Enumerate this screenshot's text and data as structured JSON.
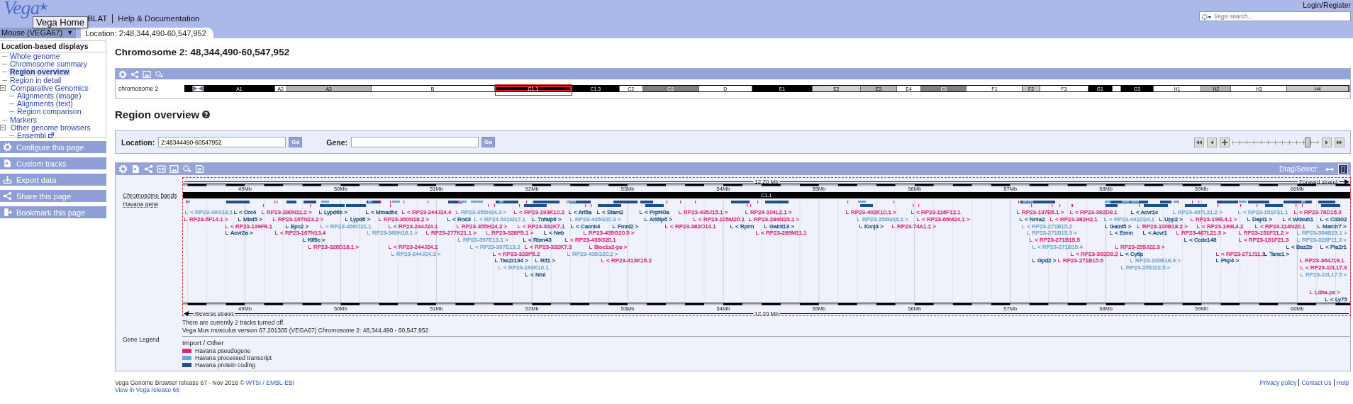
{
  "header": {
    "logo": "Vega",
    "tooltip": "Vega Home",
    "links": [
      "BLAT",
      "Help & Documentation"
    ],
    "login": "Login/Register",
    "search": {
      "placeholder": "Vega search..."
    }
  },
  "species_selector": {
    "label": "Mouse (VEGA67)",
    "caret": "▼"
  },
  "tabs": [
    {
      "label": "Location: 2:48,344,490-60,547,952",
      "selected": true
    }
  ],
  "sidebar": {
    "title": "Location-based displays",
    "items": [
      {
        "label": "Whole genome",
        "selected": false
      },
      {
        "label": "Chromosome summary",
        "selected": false
      },
      {
        "label": "Region overview",
        "selected": true
      },
      {
        "label": "Region in detail",
        "selected": false
      },
      {
        "label": "Comparative Genomics",
        "selected": false,
        "expanded": true,
        "children": [
          {
            "label": "Alignments (image)",
            "selected": false
          },
          {
            "label": "Alignments (text)",
            "selected": false
          },
          {
            "label": "Region comparison",
            "selected": false
          }
        ]
      },
      {
        "label": "Markers",
        "selected": false
      },
      {
        "label": "Other genome browsers",
        "selected": false,
        "expanded": true,
        "children": [
          {
            "label": "Ensembl",
            "selected": false,
            "external": true
          }
        ]
      }
    ]
  },
  "sidebar_buttons": [
    "Configure this page",
    "Custom tracks",
    "Export data",
    "Share this page",
    "Bookmark this page"
  ],
  "page_title": "Chromosome 2: 48,344,490-60,547,952",
  "ideogram": {
    "label": "chromosome 2",
    "bands": [
      {
        "label": "A1",
        "color": "#000000",
        "selected": false
      },
      {
        "label": "A2",
        "color": "#ffffff",
        "selected": false
      },
      {
        "label": "A3",
        "color": "#b4b4b4",
        "selected": false
      },
      {
        "label": "B",
        "color": "#ffffff",
        "selected": false
      },
      {
        "label": "C1.1",
        "color": "#000000",
        "selected": true
      },
      {
        "label": "C1.3",
        "color": "#000000",
        "selected": false
      },
      {
        "label": "C2",
        "color": "#ffffff",
        "selected": false
      },
      {
        "label": "C3",
        "color": "#808080",
        "selected": false
      },
      {
        "label": "D",
        "color": "#ffffff",
        "selected": false
      },
      {
        "label": "E1",
        "color": "#000000",
        "selected": false
      },
      {
        "label": "E2",
        "color": "#d2d2d2",
        "selected": false
      },
      {
        "label": "E3",
        "color": "#b4b4b4",
        "selected": false
      },
      {
        "label": "E4",
        "color": "#ffffff",
        "selected": false
      },
      {
        "label": "E5",
        "color": "#808080",
        "selected": false
      },
      {
        "label": "F1",
        "color": "#ffffff",
        "selected": false
      },
      {
        "label": "F2",
        "color": "#c8c8c8",
        "selected": false
      },
      {
        "label": "F3",
        "color": "#ffffff",
        "selected": false
      },
      {
        "label": "G1",
        "color": "#000000",
        "selected": false
      },
      {
        "color": "#ffffff",
        "selected": false
      },
      {
        "label": "G3",
        "color": "#000000",
        "selected": false
      },
      {
        "label": "H1",
        "color": "#ffffff",
        "selected": false
      },
      {
        "label": "H2",
        "color": "#b4b4b4",
        "selected": false
      },
      {
        "label": "H3",
        "color": "#ffffff",
        "selected": false
      },
      {
        "label": "H4",
        "color": "#c8c8c8",
        "selected": false
      }
    ]
  },
  "region_heading": "Region overview",
  "location_form": {
    "fields": [
      {
        "label": "Location:",
        "value": "2:48344490-60547952",
        "button": "Go"
      },
      {
        "label": "Gene:",
        "button": "Go"
      }
    ],
    "zoom_slider": {
      "level": 0.87
    }
  },
  "track_panel": {
    "drag_select": {
      "label": "Drag/Select:",
      "modes": [
        {
          "selected": false
        },
        {
          "selected": true
        }
      ]
    },
    "track_labels": [
      "Chromosome bands",
      "Havana gene"
    ],
    "scale_top": "12.20 Mb",
    "forward_strand": "Forward strand",
    "ruler_top": [
      "49Mb",
      "50Mb",
      "51Mb",
      "52Mb",
      "53Mb",
      "54Mb",
      "55Mb",
      "56Mb",
      "57Mb",
      "58Mb",
      "59Mb",
      "60Mb"
    ],
    "band": "C1.1",
    "genes": [
      {
        "label": "< RP23-49G18.1",
        "color": "#72a6d8"
      },
      {
        "label": "< Orc4",
        "color": "#1c4f8c"
      },
      {
        "label": "RP23-280N11.2 >",
        "color": "#dc2a7c"
      },
      {
        "label": "Lypd6b >",
        "color": "#1c4f8c"
      },
      {
        "label": "< Mmadhc",
        "color": "#1c4f8c"
      },
      {
        "label": "< RP23-244J24.4",
        "color": "#dc2a7c"
      },
      {
        "label": "RP23-355H24.3 >",
        "color": "#72a6d8"
      },
      {
        "label": "< RP23-193K10.2",
        "color": "#dc2a7c"
      },
      {
        "label": "< Arl5a",
        "color": "#1c4f8c"
      },
      {
        "label": "< Stam2",
        "color": "#1c4f8c"
      },
      {
        "label": "< Prpf40a",
        "color": "#1c4f8c"
      },
      {
        "label": "RP23-435J15.1 >",
        "color": "#dc2a7c"
      },
      {
        "label": "RP24-104L2.1 >",
        "color": "#dc2a7c"
      },
      {
        "label": "RP23-402K10.1 >",
        "color": "#dc2a7c"
      },
      {
        "label": "< RP23-116F12.1",
        "color": "#dc2a7c"
      },
      {
        "label": "RP23-137E6.1 >",
        "color": "#dc2a7c"
      },
      {
        "label": "< RP23-392D9.1",
        "color": "#dc2a7c"
      },
      {
        "label": "< Acvr1c",
        "color": "#1c4f8c"
      },
      {
        "label": "RP23-467L21.2 >",
        "color": "#72a6d8"
      },
      {
        "label": "< RP23-151F21.1",
        "color": "#72a6d8"
      },
      {
        "label": "< RP23-78D16.3",
        "color": "#dc2a7c"
      },
      {
        "label": "RP23-5F14.1 >",
        "color": "#dc2a7c"
      },
      {
        "label": "Mbd5 >",
        "color": "#1c4f8c"
      },
      {
        "label": "RP23-167N13.2 >",
        "color": "#dc2a7c"
      },
      {
        "label": "Lypd6 >",
        "color": "#1c4f8c"
      },
      {
        "label": "RP23-360N18.2 >",
        "color": "#dc2a7c"
      },
      {
        "label": "< Rnd3",
        "color": "#1c4f8c"
      },
      {
        "label": "< RP24-531M17.1",
        "color": "#72a6d8"
      },
      {
        "label": "Tnfaip6 >",
        "color": "#1c4f8c"
      },
      {
        "label": "RP23-435G20.3 >",
        "color": "#72a6d8"
      },
      {
        "label": "Arl6ip6 >",
        "color": "#1c4f8c"
      },
      {
        "label": "< RP23-105M20.1",
        "color": "#dc2a7c"
      },
      {
        "label": "RP23-284N23.1 >",
        "color": "#dc2a7c"
      },
      {
        "label": "RP23-256M16.1 >",
        "color": "#72a6d8"
      },
      {
        "label": "< RP23-66M24.1 >",
        "color": "#dc2a7c"
      },
      {
        "label": "< Nr4a2",
        "color": "#1c4f8c"
      },
      {
        "label": "< RP23-382H2.1",
        "color": "#dc2a7c"
      },
      {
        "label": "< RP23-441D24.1",
        "color": "#72a6d8"
      },
      {
        "label": "Upp2 >",
        "color": "#1c4f8c"
      },
      {
        "label": "RP23-199L4.1 >",
        "color": "#dc2a7c"
      },
      {
        "label": "Dapl1 >",
        "color": "#1c4f8c"
      },
      {
        "label": "< Wdsub1",
        "color": "#1c4f8c"
      },
      {
        "label": "< Cd302",
        "color": "#1c4f8c"
      },
      {
        "label": "< RP23-139F8.1",
        "color": "#dc2a7c"
      },
      {
        "label": "Epc2 >",
        "color": "#1c4f8c"
      },
      {
        "label": "< RP23-466O21.1",
        "color": "#72a6d8"
      },
      {
        "label": "< RP23-244J24.1",
        "color": "#dc2a7c"
      },
      {
        "label": "RP23-355H24.2 >",
        "color": "#dc2a7c"
      },
      {
        "label": "< RP23-332K7.1",
        "color": "#dc2a7c"
      },
      {
        "label": "< Cacnb4",
        "color": "#1c4f8c"
      },
      {
        "label": "Fmnl2 >",
        "color": "#1c4f8c"
      },
      {
        "label": "< RP23-382O14.1",
        "color": "#dc2a7c"
      },
      {
        "label": "< Rprm",
        "color": "#1c4f8c"
      },
      {
        "label": "Galnt13 >",
        "color": "#1c4f8c"
      },
      {
        "label": "Kcnj3 >",
        "color": "#1c4f8c"
      },
      {
        "label": "RP23-74A1.1 >",
        "color": "#dc2a7c"
      },
      {
        "label": "< RP23-271B15.2",
        "color": "#72a6d8"
      },
      {
        "label": "Galnt5 >",
        "color": "#1c4f8c"
      },
      {
        "label": "RP23-100B18.2 >",
        "color": "#dc2a7c"
      },
      {
        "label": "< RP23-199L4.2",
        "color": "#dc2a7c"
      },
      {
        "label": "< RP23-114N20.1",
        "color": "#dc2a7c"
      },
      {
        "label": "March7 >",
        "color": "#1c4f8c"
      },
      {
        "label": "Acvr2a >",
        "color": "#1c4f8c"
      },
      {
        "label": "< RP23-167N13.4",
        "color": "#dc2a7c"
      },
      {
        "label": "RP23-360N18.1 >",
        "color": "#72a6d8"
      },
      {
        "label": "RP23-277K21.1 >",
        "color": "#dc2a7c"
      },
      {
        "label": "RP23-328P5.1 >",
        "color": "#dc2a7c"
      },
      {
        "label": "< Neb",
        "color": "#1c4f8c"
      },
      {
        "label": "RP23-435G20.5 >",
        "color": "#dc2a7c"
      },
      {
        "label": "< RP23-289M11.1",
        "color": "#dc2a7c"
      },
      {
        "label": "RP23-271B15.3 >",
        "color": "#72a6d8"
      },
      {
        "label": "< Ermn",
        "color": "#1c4f8c"
      },
      {
        "label": "< Acvr1",
        "color": "#1c4f8c"
      },
      {
        "label": "RP23-467L21.3 >",
        "color": "#dc2a7c"
      },
      {
        "label": "RP23-151F21.2 >",
        "color": "#dc2a7c"
      },
      {
        "label": "RP23-364B23.1 >",
        "color": "#72a6d8"
      },
      {
        "label": "Kif5c >",
        "color": "#1c4f8c"
      },
      {
        "label": "RP23-397E13.1 >",
        "color": "#72a6d8"
      },
      {
        "label": "< Rbm43",
        "color": "#1c4f8c"
      },
      {
        "label": "< RP23-435G20.1",
        "color": "#dc2a7c"
      },
      {
        "label": "< RP23-271B15.5",
        "color": "#dc2a7c"
      },
      {
        "label": "< Ccdc148",
        "color": "#1c4f8c"
      },
      {
        "label": "< RP23-151F21.3",
        "color": "#dc2a7c"
      },
      {
        "label": "RP23-323P11.3 >",
        "color": "#72a6d8"
      },
      {
        "label": "RP23-326D18.1 >",
        "color": "#dc2a7c"
      },
      {
        "label": "< RP23-244J24.2",
        "color": "#dc2a7c"
      },
      {
        "label": "< RP23-397E13.2",
        "color": "#72a6d8"
      },
      {
        "label": "< RP23-332K7.3",
        "color": "#dc2a7c"
      },
      {
        "label": "Bloc1s2-ps >",
        "color": "#dc2a7c"
      },
      {
        "label": "< RP23-271B15.4",
        "color": "#72a6d8"
      },
      {
        "label": "RP23-255J22.3 >",
        "color": "#dc2a7c"
      },
      {
        "label": "< Baz2b",
        "color": "#1c4f8c"
      },
      {
        "label": "< Pla2r1",
        "color": "#1c4f8c"
      },
      {
        "label": "RP23-244J24.3 >",
        "color": "#72a6d8"
      },
      {
        "label": "< RP23-328P5.2",
        "color": "#dc2a7c"
      },
      {
        "label": "RP23-435G20.2 >",
        "color": "#72a6d8"
      },
      {
        "label": "< RP23-392D9.2",
        "color": "#dc2a7c"
      },
      {
        "label": "< Cytip",
        "color": "#1c4f8c"
      },
      {
        "label": "< RP23-271J11.1",
        "color": "#dc2a7c"
      },
      {
        "label": "Tanc1 >",
        "color": "#1c4f8c"
      },
      {
        "label": "Tas2r134 >",
        "color": "#1c4f8c"
      },
      {
        "label": "Rif1 >",
        "color": "#1c4f8c"
      },
      {
        "label": "< RP23-413K16.2",
        "color": "#dc2a7c"
      },
      {
        "label": "Gpd2 >",
        "color": "#1c4f8c"
      },
      {
        "label": "RP23-271B15.6",
        "color": "#dc2a7c"
      },
      {
        "label": "RP23-100B18.3 >",
        "color": "#72a6d8"
      },
      {
        "label": "Pkp4 >",
        "color": "#1c4f8c"
      },
      {
        "label": "RP23-364J19.1",
        "color": "#dc2a7c"
      },
      {
        "label": "< RP23-193K10.1",
        "color": "#72a6d8"
      },
      {
        "label": "RP23-255J22.5 >",
        "color": "#72a6d8"
      },
      {
        "label": "< RP23-10L17.3",
        "color": "#dc2a7c"
      },
      {
        "label": "< Nmi",
        "color": "#1c4f8c"
      },
      {
        "label": "RP23-10L17.5 >",
        "color": "#72a6d8"
      },
      {
        "label": "Ldha-ps >",
        "color": "#dc2a7c"
      },
      {
        "label": "< Ly75",
        "color": "#1c4f8c"
      }
    ],
    "ruler_bottom": [
      "49Mb",
      "50Mb",
      "51Mb",
      "52Mb",
      "53Mb",
      "54Mb",
      "55Mb",
      "56Mb",
      "57Mb",
      "58Mb",
      "59Mb",
      "60Mb"
    ],
    "reverse_strand": "Reverse strand",
    "scale_bottom": "12.20 Mb",
    "notes": [
      "There are currently 2 tracks turned off.",
      "Vega Mus musculus version 67.201305 (VEGA67) Chromosome 2: 48,344,490 - 60,547,952"
    ],
    "legend": {
      "title": "Gene Legend",
      "group": "Import / Other",
      "items": [
        {
          "label": "Havana pseudogene",
          "color": "#dc2a7c"
        },
        {
          "label": "Havana processed transcript",
          "color": "#72a6d8"
        },
        {
          "label": "Havana protein coding",
          "color": "#1c4f8c"
        }
      ]
    }
  },
  "footer": {
    "copyright": [
      {
        "text": "Vega Genome Browser release 67 - Nov 2016 ©"
      },
      {
        "link": "WTSI"
      },
      {
        "link": "/"
      },
      {
        "link": "EMBL-EBI"
      }
    ],
    "archive_link": "View in Vega release 66",
    "links": [
      "Privacy policy",
      "Contact Us",
      "Help"
    ]
  }
}
